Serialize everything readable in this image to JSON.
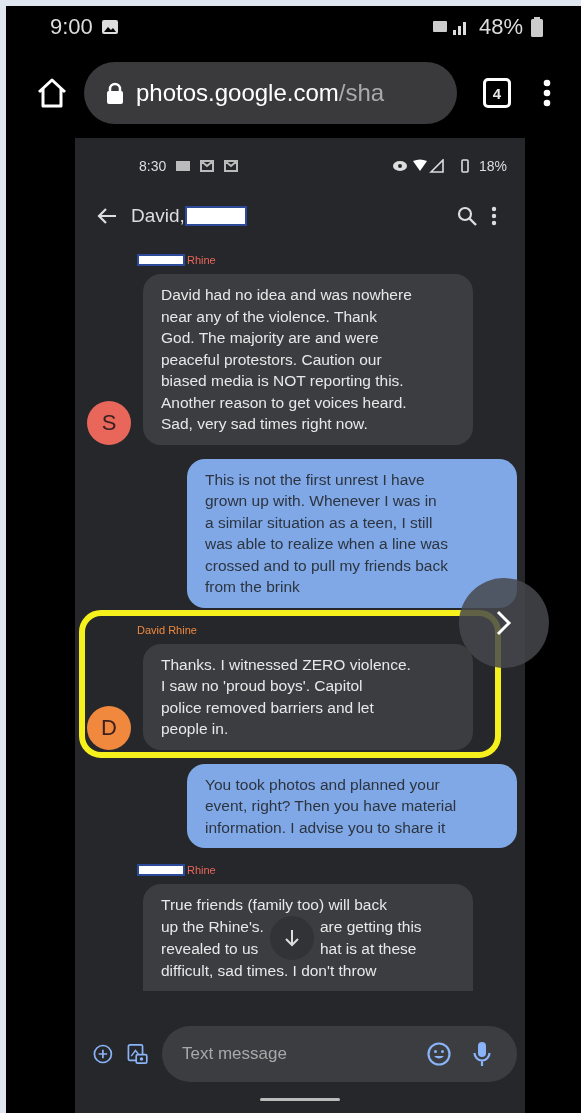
{
  "phone_status": {
    "time": "9:00",
    "battery": "48%"
  },
  "browser": {
    "url_host": "photos.google.com",
    "url_path": "/sha",
    "tab_count": "4"
  },
  "screenshot": {
    "status": {
      "time": "8:30",
      "battery": "18%"
    },
    "header": {
      "title": "David,",
      "redacted": true
    },
    "messages": [
      {
        "kind": "incoming",
        "sender": "Rhine",
        "redacted": true,
        "avatar": "S",
        "color": "#e8675a",
        "highlighted": false,
        "text": "David had no idea and was nowhere\nnear any of the violence. Thank\nGod. The majority are and were\npeaceful protestors. Caution our\nbiased media is NOT reporting this.\nAnother reason to get voices heard.\nSad, very sad times right now."
      },
      {
        "kind": "outgoing",
        "text": "This is not the first unrest I have\ngrown up with. Whenever I was in\na similar situation as a teen, I still\nwas able to realize when a line was\ncrossed and to pull my friends back\nfrom the brink"
      },
      {
        "kind": "incoming",
        "sender": "David Rhine",
        "redacted": false,
        "avatar": "D",
        "color": "#f0883e",
        "highlighted": true,
        "text": "Thanks.  I witnessed ZERO violence.\nI saw no 'proud boys'.  Capitol\npolice removed barriers and let\npeople in."
      },
      {
        "kind": "outgoing",
        "text": "You took photos and planned your\nevent, right? Then you have material\ninformation. I advise you to share it"
      },
      {
        "kind": "obscured",
        "sender": "Rhine",
        "redacted": true,
        "color": "#e8675a",
        "top": "True friends (family too) will back",
        "left": "up the Rhine's.\nrevealed to us",
        "right": "are getting this\nhat is at these",
        "bottom": "difficult, sad times. I don't throw"
      }
    ],
    "composer": {
      "placeholder": "Text message"
    }
  }
}
